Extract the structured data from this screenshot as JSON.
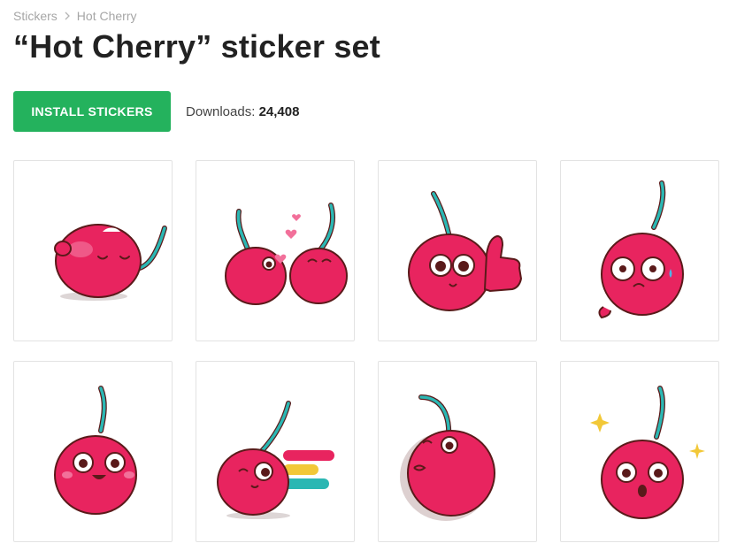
{
  "breadcrumb": {
    "root": "Stickers",
    "current": "Hot Cherry"
  },
  "title": "“Hot Cherry” sticker set",
  "install_label": "INSTALL STICKERS",
  "downloads": {
    "label": "Downloads:",
    "count": "24,408"
  },
  "colors": {
    "accent": "#24b25d",
    "cherry": "#e8245f",
    "stem": "#2bb7b3",
    "outline": "#5a1a1a"
  },
  "stickers": [
    {
      "icon": "cherry-sleeping-icon"
    },
    {
      "icon": "cherry-kiss-icon"
    },
    {
      "icon": "cherry-thumbs-up-icon"
    },
    {
      "icon": "cherry-scared-icon"
    },
    {
      "icon": "cherry-happy-icon"
    },
    {
      "icon": "cherry-running-icon"
    },
    {
      "icon": "cherry-blowing-kiss-icon"
    },
    {
      "icon": "cherry-surprised-icon"
    }
  ]
}
